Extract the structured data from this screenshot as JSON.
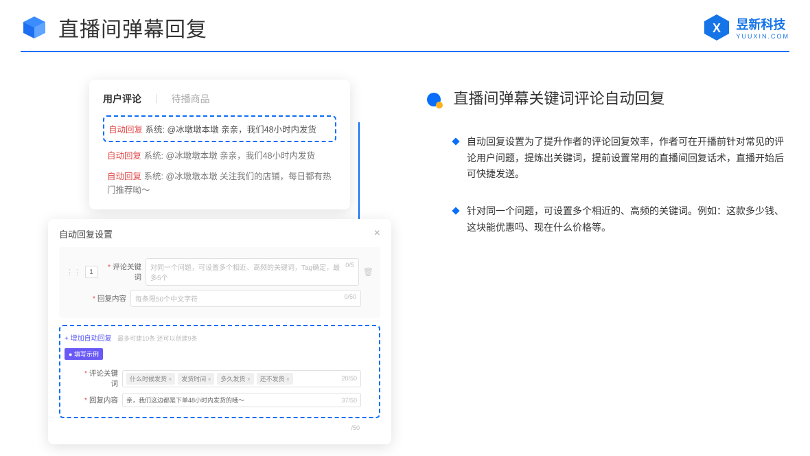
{
  "header": {
    "title": "直播间弹幕回复"
  },
  "brand": {
    "cn": "昱新科技",
    "en": "YUUXIN.COM"
  },
  "comments": {
    "tab_active": "用户评论",
    "tab_inactive": "待播商品",
    "auto_label": "自动回复",
    "sys_prefix": "系统:",
    "row1": "@冰墩墩本墩 亲亲，我们48小时内发货",
    "row2": "@冰墩墩本墩 亲亲，我们48小时内发货",
    "row3": "@冰墩墩本墩 关注我们的店铺，每日都有热门推荐呦～"
  },
  "settings": {
    "title": "自动回复设置",
    "idx": "1",
    "label_keyword": "评论关键词",
    "placeholder_keyword": "对同一个问题，可设置多个相近、高频的关键词，Tag确定，最多5个",
    "counter_keyword": "0/5",
    "label_content": "回复内容",
    "placeholder_content": "每条限50个中文字符",
    "counter_content": "0/50",
    "add_link": "+ 增加自动回复",
    "add_hint": "最多可建10条 还可以创建9条",
    "example_badge": "● 填写示例",
    "ex_label_keyword": "评论关键词",
    "tags": [
      "什么时候发货",
      "发货时间",
      "多久发货",
      "还不发货"
    ],
    "ex_counter_keyword": "20/50",
    "ex_label_content": "回复内容",
    "ex_content": "亲，我们这边都是下单48小时内发货的哦～",
    "ex_counter_content": "37/50",
    "tail_counter": "/50"
  },
  "right": {
    "section_title": "直播间弹幕关键词评论自动回复",
    "bullets": [
      "自动回复设置为了提升作者的评论回复效率，作者可在开播前针对常见的评论用户问题，提炼出关键词，提前设置常用的直播间回复话术，直播开始后可快捷发送。",
      "针对同一个问题，可设置多个相近的、高频的关键词。例如：这款多少钱、这块能优惠吗、现在什么价格等。"
    ]
  }
}
